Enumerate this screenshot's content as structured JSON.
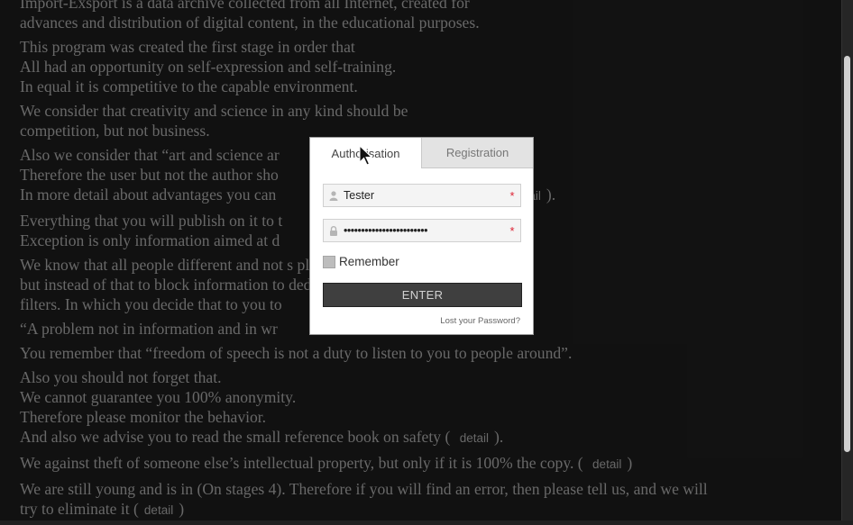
{
  "background": {
    "paragraphs": [
      {
        "lines": [
          "Import-Exsport is a data archive collected from all Internet, created for",
          "advances and distribution of digital content, in the educational purposes."
        ]
      },
      {
        "lines": [
          "This program was created the first stage in order that",
          "All had an opportunity on self-expression and self-training.",
          "In equal it is competitive to the capable environment."
        ]
      },
      {
        "lines": [
          "We consider that creativity and science in any kind should be",
          "competition, but not business."
        ]
      },
      {
        "lines": [
          "Also we consider that “art and science ar",
          "Therefore the user but not the author sho",
          "In more detail about advantages you can"
        ],
        "detail": "detail",
        "detail_suffix": ")."
      },
      {
        "lines": [
          "Everything that you will publish on it to t",
          "Exception is only information aimed at d"
        ],
        "suffix": ")."
      },
      {
        "lines": [
          "We know that all people different and not                                              s pleasant.",
          "but instead of that to block information to                                              ded to create a flexible system",
          "filters. In which you decide that to you to"
        ]
      },
      {
        "lines": [
          "“A problem not in information and in wr"
        ]
      },
      {
        "lines": [
          "You remember that “freedom of speech is not a duty to listen to you to people around”."
        ]
      },
      {
        "lines": [
          "Also you should not forget that.",
          "We cannot guarantee you 100% anonymity.",
          "Therefore please monitor the behavior.",
          "And also we advise you to read the small reference book on safety ("
        ],
        "detail": "detail",
        "detail_suffix": ")."
      },
      {
        "lines": [
          "We against theft of someone else’s intellectual property, but only if it is 100% the copy. ("
        ],
        "detail": "detail",
        "detail_suffix": ")"
      },
      {
        "lines": [
          "We are still young and is in (On stages 4). Therefore if you will find an error, then please tell us, and we will",
          "try to eliminate it ("
        ],
        "detail": "detail",
        "detail_suffix": ")"
      }
    ]
  },
  "modal": {
    "tabs": [
      {
        "label": "Authorisation",
        "active": true
      },
      {
        "label": "Registration",
        "active": false
      }
    ],
    "username": {
      "value": "Tester",
      "icon": "user-icon"
    },
    "password": {
      "value": "••••••••••••••••••••••••",
      "icon": "lock-icon"
    },
    "required_mark": "*",
    "remember_label": "Remember",
    "enter_label": "ENTER",
    "lost_password": "Lost your Password?"
  }
}
